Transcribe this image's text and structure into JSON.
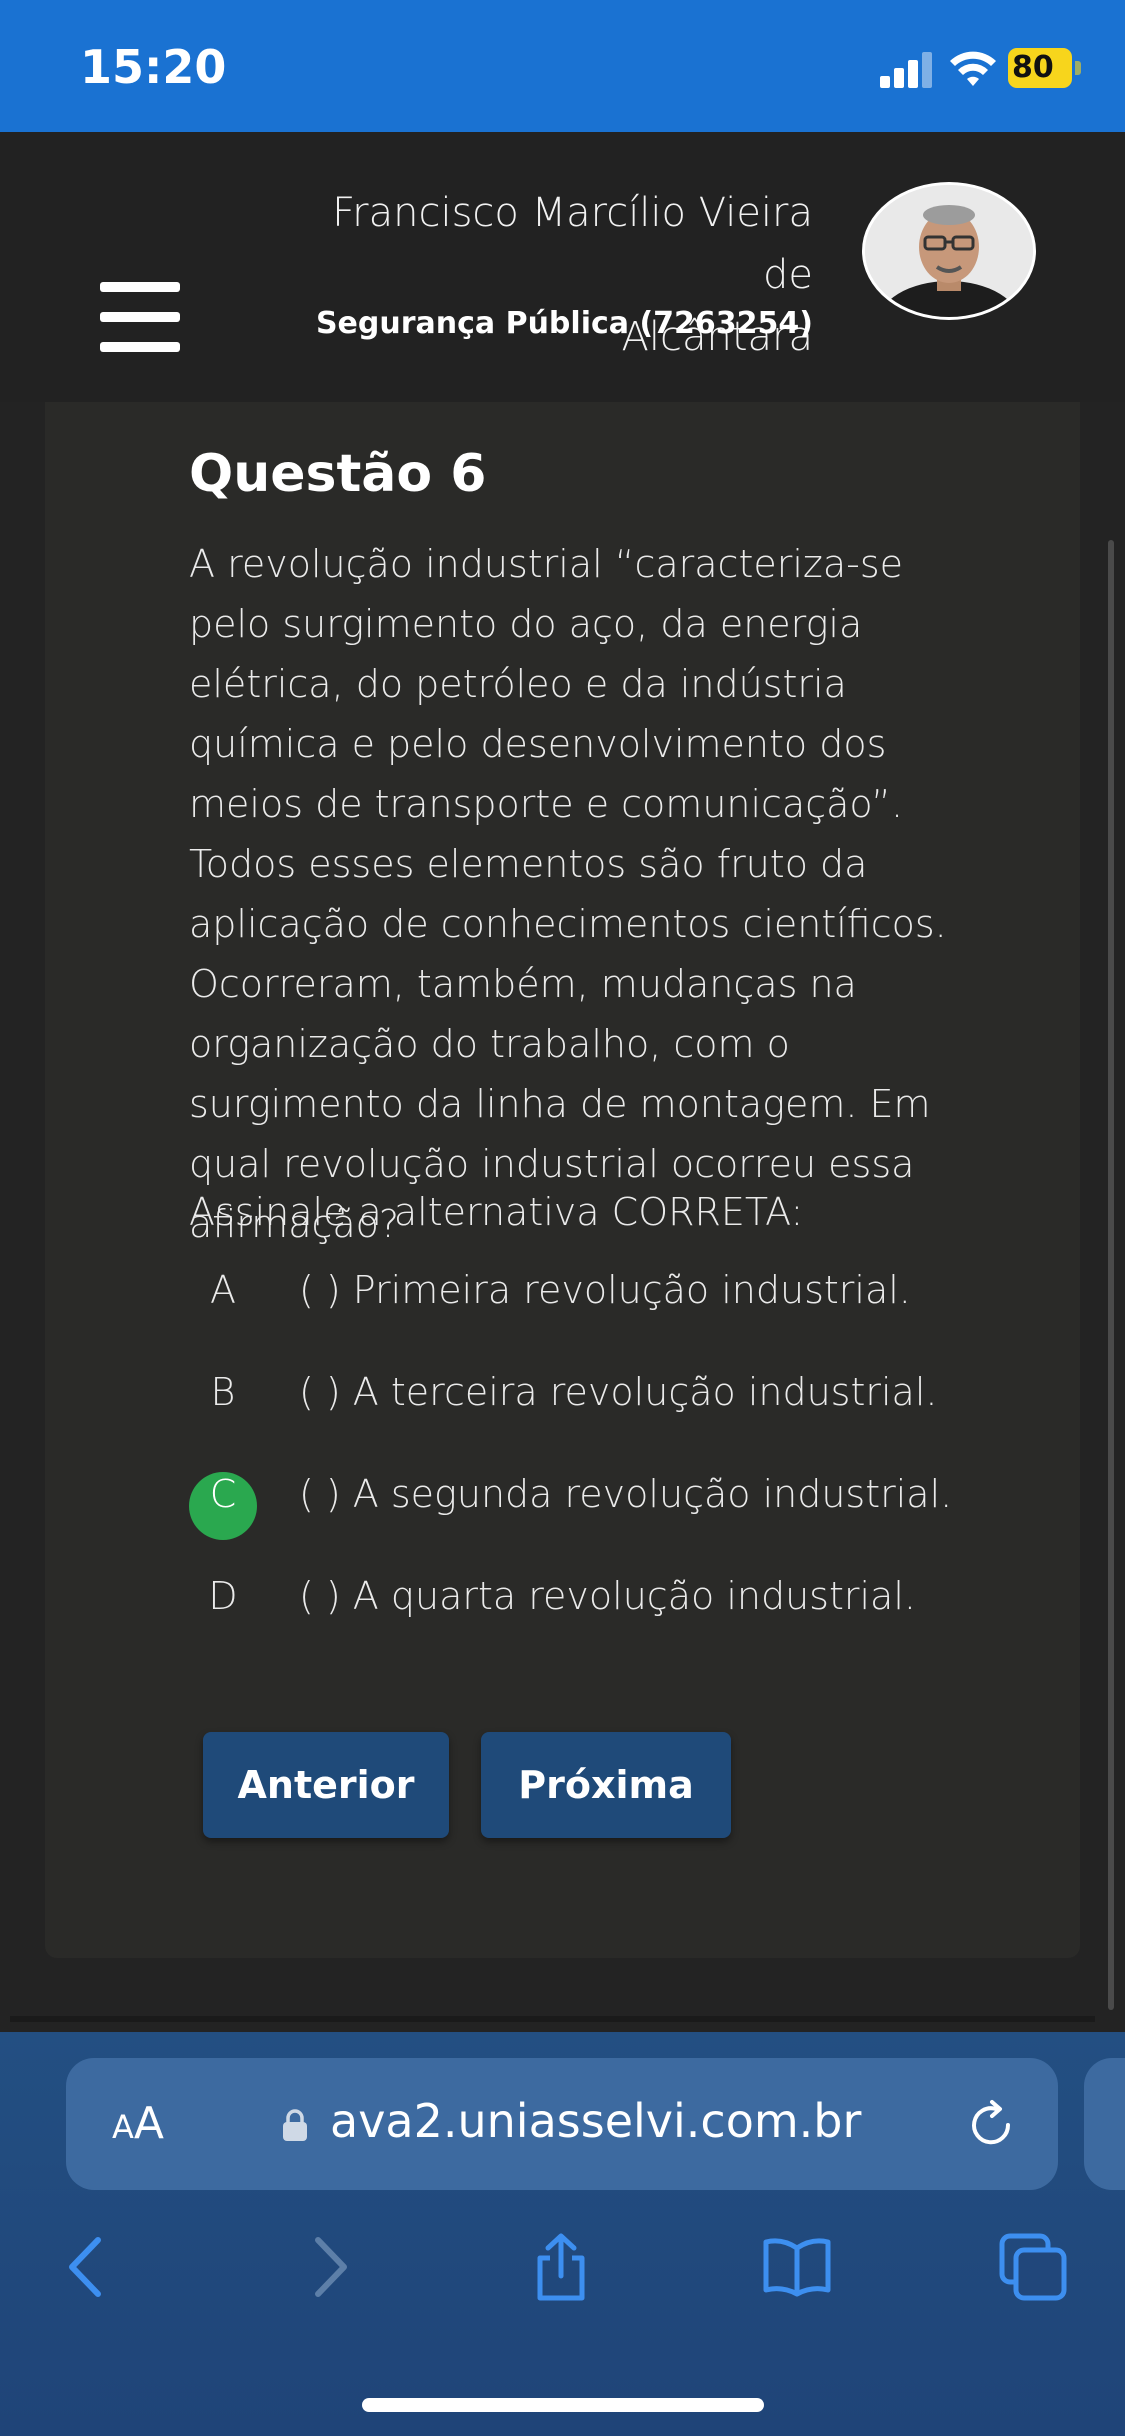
{
  "status_bar": {
    "time": "15:20",
    "battery": "80",
    "icons": [
      "signal-icon",
      "wifi-icon",
      "battery-charging-icon"
    ]
  },
  "header": {
    "user_name_line1": "Francisco Marcílio Vieira de",
    "user_name_line2": "Alcântara",
    "course": "Segurança Pública (7263254)",
    "menu_icon": "hamburger-menu-icon"
  },
  "question": {
    "title": "Questão 6",
    "text": "A revolução industrial “caracteriza-se pelo surgimento do aço, da energia elétrica, do petróleo e da indústria química e pelo desenvolvimento dos meios de transporte e comunicação”. Todos esses elementos são fruto da aplicação de conhecimentos científicos. Ocorreram, também, mudanças na organização do trabalho, com o surgimento da linha de montagem. Em qual revolução industrial ocorreu essa afirmação?",
    "instruction": "Assinale a alternativa CORRETA:",
    "options": [
      {
        "letter": "A",
        "text": "(   ) Primeira revolução industrial.",
        "selected": false
      },
      {
        "letter": "B",
        "text": "(   ) A terceira revolução industrial.",
        "selected": false
      },
      {
        "letter": "C",
        "text": "(   ) A segunda revolução industrial.",
        "selected": true
      },
      {
        "letter": "D",
        "text": "(   ) A quarta revolução industrial.",
        "selected": false
      }
    ],
    "selected_color": "#2aa84f"
  },
  "nav": {
    "prev_label": "Anterior",
    "next_label": "Próxima"
  },
  "browser": {
    "aa_label_small": "A",
    "aa_label": "A",
    "url": "ava2.uniasselvi.com.br",
    "toolbar_icons": [
      "back-icon",
      "forward-icon",
      "share-icon",
      "bookmarks-icon",
      "tabs-icon"
    ]
  },
  "colors": {
    "status_bar": "#1a72d2",
    "button": "#1f4a79",
    "safari_bar": "#234f82"
  }
}
